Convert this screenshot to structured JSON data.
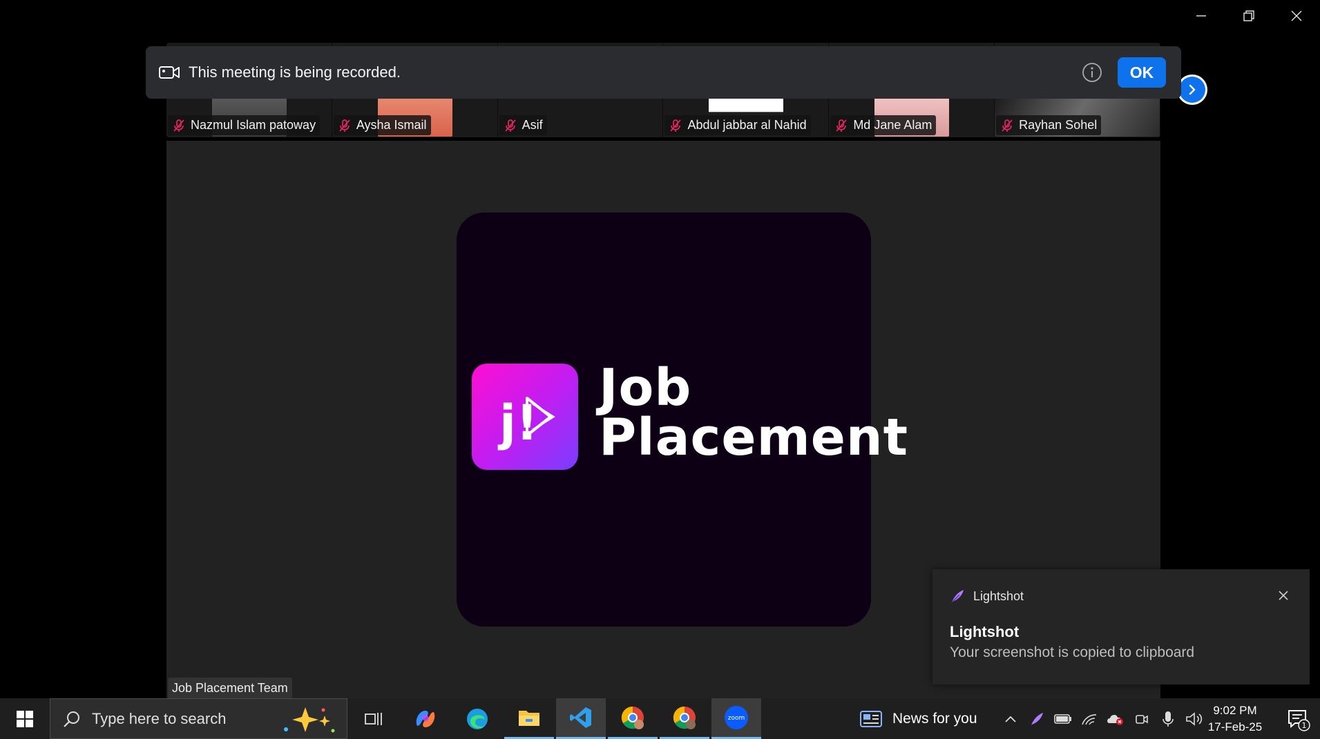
{
  "window": {
    "controls": [
      "minimize",
      "restore",
      "close"
    ]
  },
  "banner": {
    "text": "This meeting is being recorded.",
    "ok_label": "OK"
  },
  "participants": [
    {
      "name": "Nazmul Islam patoway",
      "muted": true
    },
    {
      "name": "Aysha Ismail",
      "muted": true
    },
    {
      "name": "Asif",
      "muted": true
    },
    {
      "name": "Abdul jabbar al Nahid",
      "muted": true
    },
    {
      "name": "Md Jane Alam",
      "muted": true
    },
    {
      "name": "Rayhan Sohel",
      "muted": true
    }
  ],
  "stage": {
    "logo_line1": "Job",
    "logo_line2": "Placement",
    "speaker_label": "Job Placement Team"
  },
  "toast": {
    "app": "Lightshot",
    "title": "Lightshot",
    "body": "Your screenshot is copied to clipboard"
  },
  "taskbar": {
    "search_placeholder": "Type here to search",
    "news_label": "News for you",
    "time": "9:02 PM",
    "date": "17-Feb-25",
    "notification_count": "1"
  },
  "colors": {
    "zoom_blue": "#0e72ed",
    "logo_gradient_start": "#ff0fd3",
    "logo_gradient_end": "#7a3dff"
  }
}
